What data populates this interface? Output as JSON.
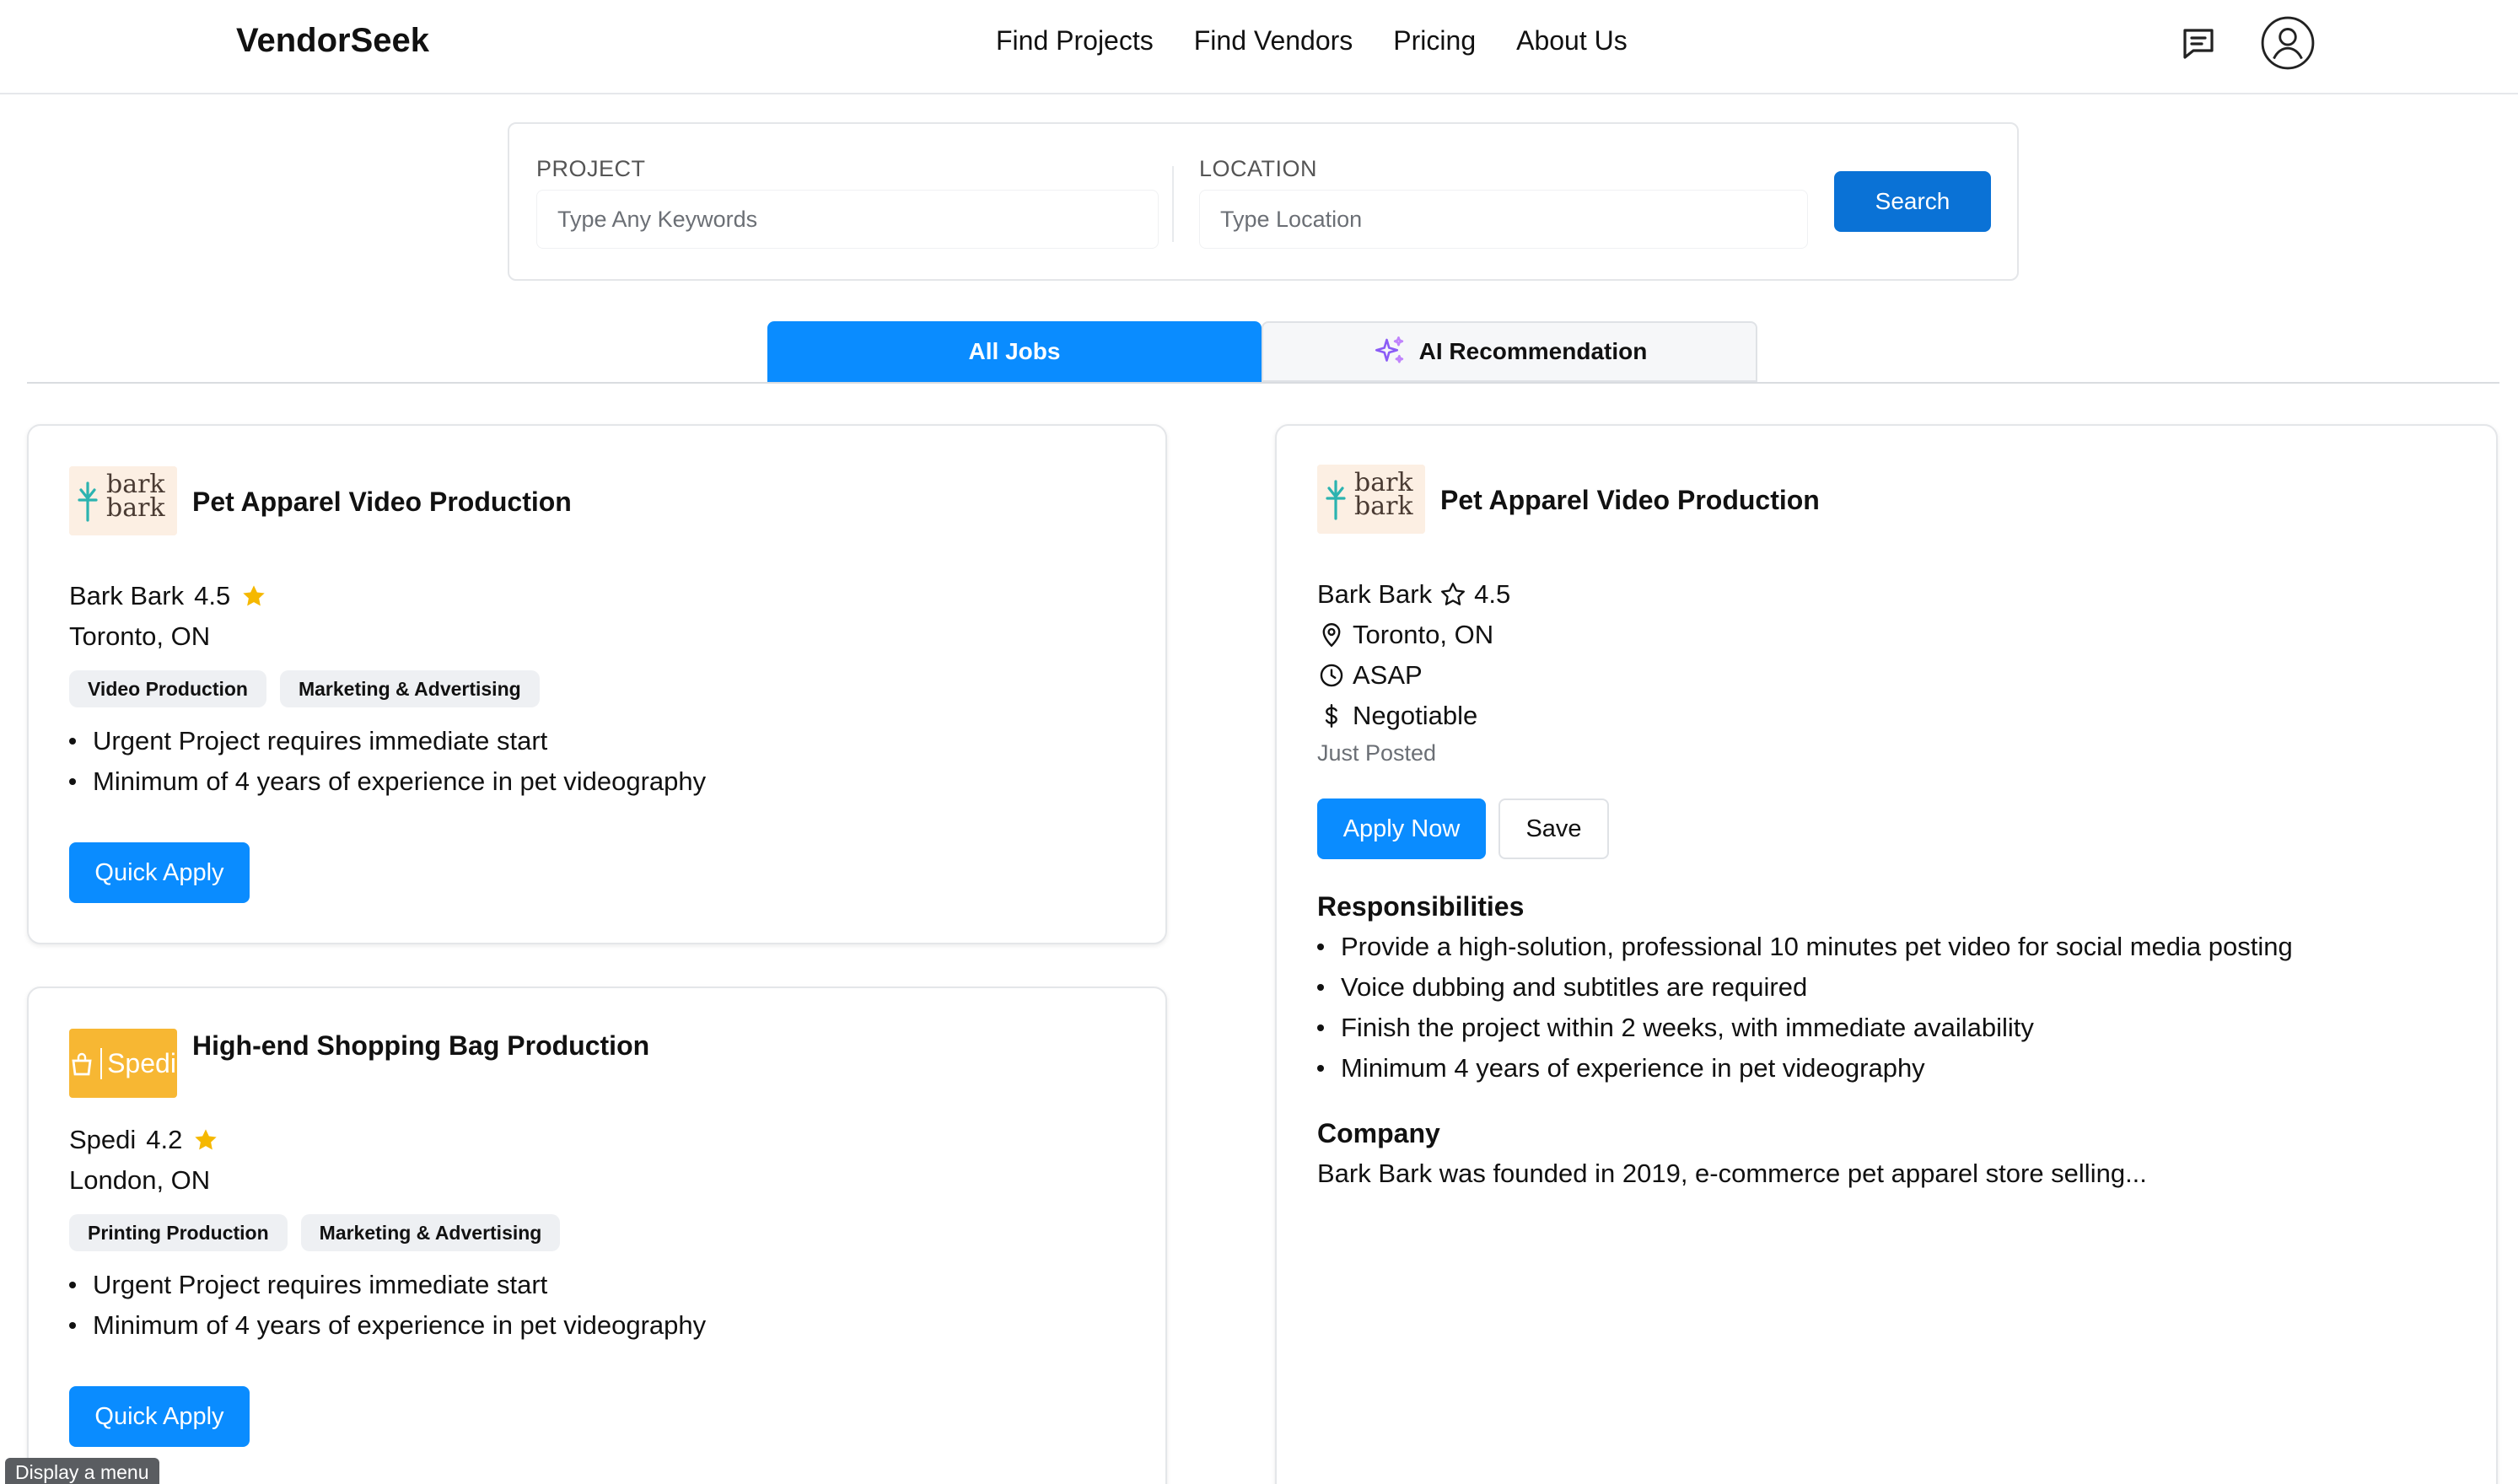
{
  "header": {
    "logo": "VendorSeek",
    "nav": [
      "Find Projects",
      "Find Vendors",
      "Pricing",
      "About Us"
    ]
  },
  "search": {
    "project_label": "PROJECT",
    "project_placeholder": "Type Any Keywords",
    "location_label": "LOCATION",
    "location_placeholder": "Type Location",
    "button": "Search"
  },
  "tabs": {
    "all_jobs": "All Jobs",
    "ai": "AI Recommendation",
    "active": "All Jobs"
  },
  "jobs": [
    {
      "logo_text": [
        "bark",
        "bark"
      ],
      "title": "Pet Apparel Video Production",
      "company": "Bark Bark",
      "rating": "4.5",
      "location": "Toronto, ON",
      "tags": [
        "Video Production",
        "Marketing & Advertising"
      ],
      "bullets": [
        "Urgent Project requires immediate start",
        "Minimum of 4 years of experience in pet videography"
      ],
      "button": "Quick Apply"
    },
    {
      "logo_text": "Spedi",
      "title": "High-end Shopping Bag Production",
      "company": "Spedi",
      "rating": "4.2",
      "location": "London, ON",
      "tags": [
        "Printing Production",
        "Marketing & Advertising"
      ],
      "bullets": [
        "Urgent Project requires immediate start",
        "Minimum of 4 years of experience in pet videography"
      ],
      "button": "Quick Apply"
    }
  ],
  "detail": {
    "logo_text": [
      "bark",
      "bark"
    ],
    "title": "Pet Apparel Video Production",
    "company": "Bark Bark",
    "rating": "4.5",
    "location": "Toronto, ON",
    "timing": "ASAP",
    "budget": "Negotiable",
    "posted": "Just Posted",
    "apply": "Apply Now",
    "save": "Save",
    "responsibilities_heading": "Responsibilities",
    "responsibilities": [
      "Provide a high-solution, professional 10 minutes pet video for social media posting",
      "Voice dubbing and subtitles are required",
      "Finish the project within 2 weeks, with immediate availability",
      "Minimum 4 years of experience in pet videography"
    ],
    "company_heading": "Company",
    "company_text": "Bark Bark was founded in 2019, e-commerce pet apparel store selling..."
  },
  "tooltip": "Display a menu",
  "colors": {
    "accent": "#0a8cff",
    "search_button": "#0a72d6",
    "star": "#f5b800",
    "spedi_logo": "#f7b733"
  }
}
